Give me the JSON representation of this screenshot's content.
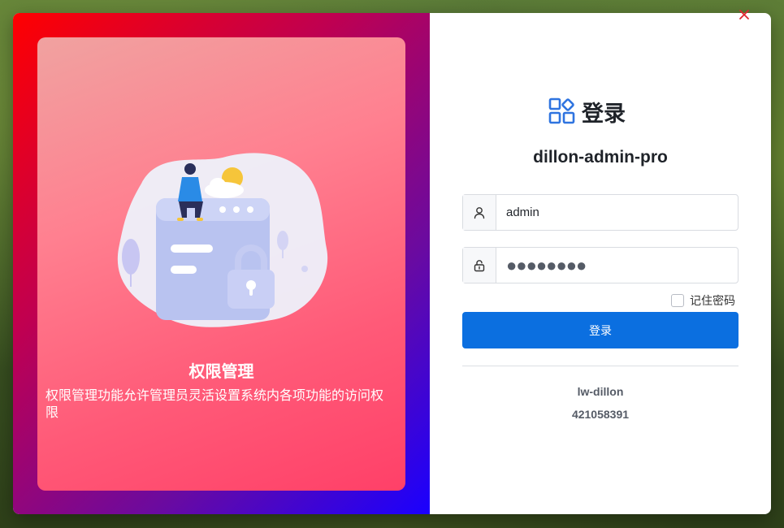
{
  "left_card": {
    "title": "权限管理",
    "description": "权限管理功能允许管理员灵活设置系统内各项功能的访问权限"
  },
  "login": {
    "brand_title": "登录",
    "app_name": "dillon-admin-pro",
    "username_value": "admin",
    "password_masked": "●●●●●●●●",
    "remember_label": "记住密码",
    "remember_checked": false,
    "submit_label": "登录"
  },
  "footer": {
    "author": "lw-dillon",
    "contact": "421058391"
  },
  "colors": {
    "primary": "#0b6fe0",
    "close": "#e0262f",
    "brand_icon": "#2f74e0"
  },
  "icons": {
    "close": "close-icon",
    "user": "user-icon",
    "lock": "lock-icon",
    "brand": "apps-grid-icon"
  }
}
